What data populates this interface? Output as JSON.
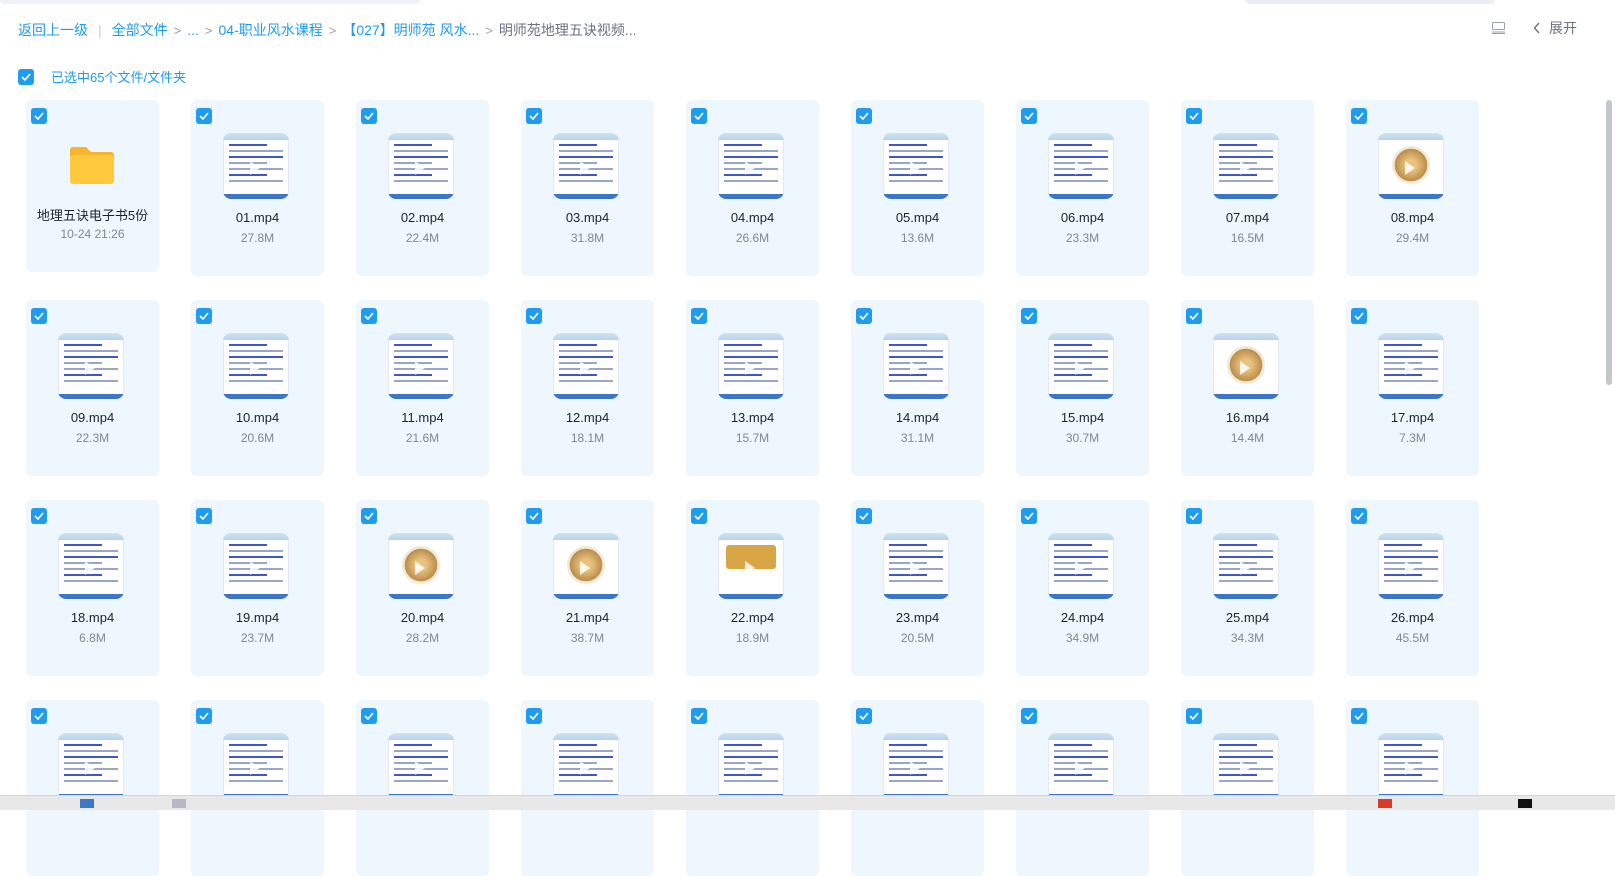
{
  "breadcrumb": {
    "back": "返回上一级",
    "items": [
      "全部文件",
      "...",
      "04-职业风水课程",
      "【027】明师苑 风水...",
      "明师苑地理五诀视频..."
    ]
  },
  "toolbar": {
    "expand_label": "展开"
  },
  "selection": {
    "label": "已选中65个文件/文件夹",
    "checked": true
  },
  "folder": {
    "name": "地理五诀电子书5份",
    "date": "10-24 21:26"
  },
  "files": [
    {
      "name": "01.mp4",
      "size": "27.8M"
    },
    {
      "name": "02.mp4",
      "size": "22.4M"
    },
    {
      "name": "03.mp4",
      "size": "31.8M"
    },
    {
      "name": "04.mp4",
      "size": "26.6M"
    },
    {
      "name": "05.mp4",
      "size": "13.6M"
    },
    {
      "name": "06.mp4",
      "size": "23.3M"
    },
    {
      "name": "07.mp4",
      "size": "16.5M"
    },
    {
      "name": "08.mp4",
      "size": "29.4M"
    },
    {
      "name": "09.mp4",
      "size": "22.3M"
    },
    {
      "name": "10.mp4",
      "size": "20.6M"
    },
    {
      "name": "11.mp4",
      "size": "21.6M"
    },
    {
      "name": "12.mp4",
      "size": "18.1M"
    },
    {
      "name": "13.mp4",
      "size": "15.7M"
    },
    {
      "name": "14.mp4",
      "size": "31.1M"
    },
    {
      "name": "15.mp4",
      "size": "30.7M"
    },
    {
      "name": "16.mp4",
      "size": "14.4M"
    },
    {
      "name": "17.mp4",
      "size": "7.3M"
    },
    {
      "name": "18.mp4",
      "size": "6.8M"
    },
    {
      "name": "19.mp4",
      "size": "23.7M"
    },
    {
      "name": "20.mp4",
      "size": "28.2M"
    },
    {
      "name": "21.mp4",
      "size": "38.7M"
    },
    {
      "name": "22.mp4",
      "size": "18.9M"
    },
    {
      "name": "23.mp4",
      "size": "20.5M"
    },
    {
      "name": "24.mp4",
      "size": "34.9M"
    },
    {
      "name": "25.mp4",
      "size": "34.3M"
    },
    {
      "name": "26.mp4",
      "size": "45.5M"
    },
    {
      "name": "",
      "size": ""
    },
    {
      "name": "",
      "size": ""
    },
    {
      "name": "",
      "size": ""
    },
    {
      "name": "",
      "size": ""
    },
    {
      "name": "",
      "size": ""
    },
    {
      "name": "",
      "size": ""
    },
    {
      "name": "",
      "size": ""
    },
    {
      "name": "",
      "size": ""
    },
    {
      "name": "",
      "size": ""
    }
  ],
  "colors": {
    "accent": "#1f9cf0",
    "card_bg": "#eef7fe",
    "folder": "#ffc83d"
  },
  "icons": [
    "checkbox-checked-icon",
    "list-view-icon",
    "chevron-left-icon",
    "folder-icon",
    "play-icon"
  ]
}
